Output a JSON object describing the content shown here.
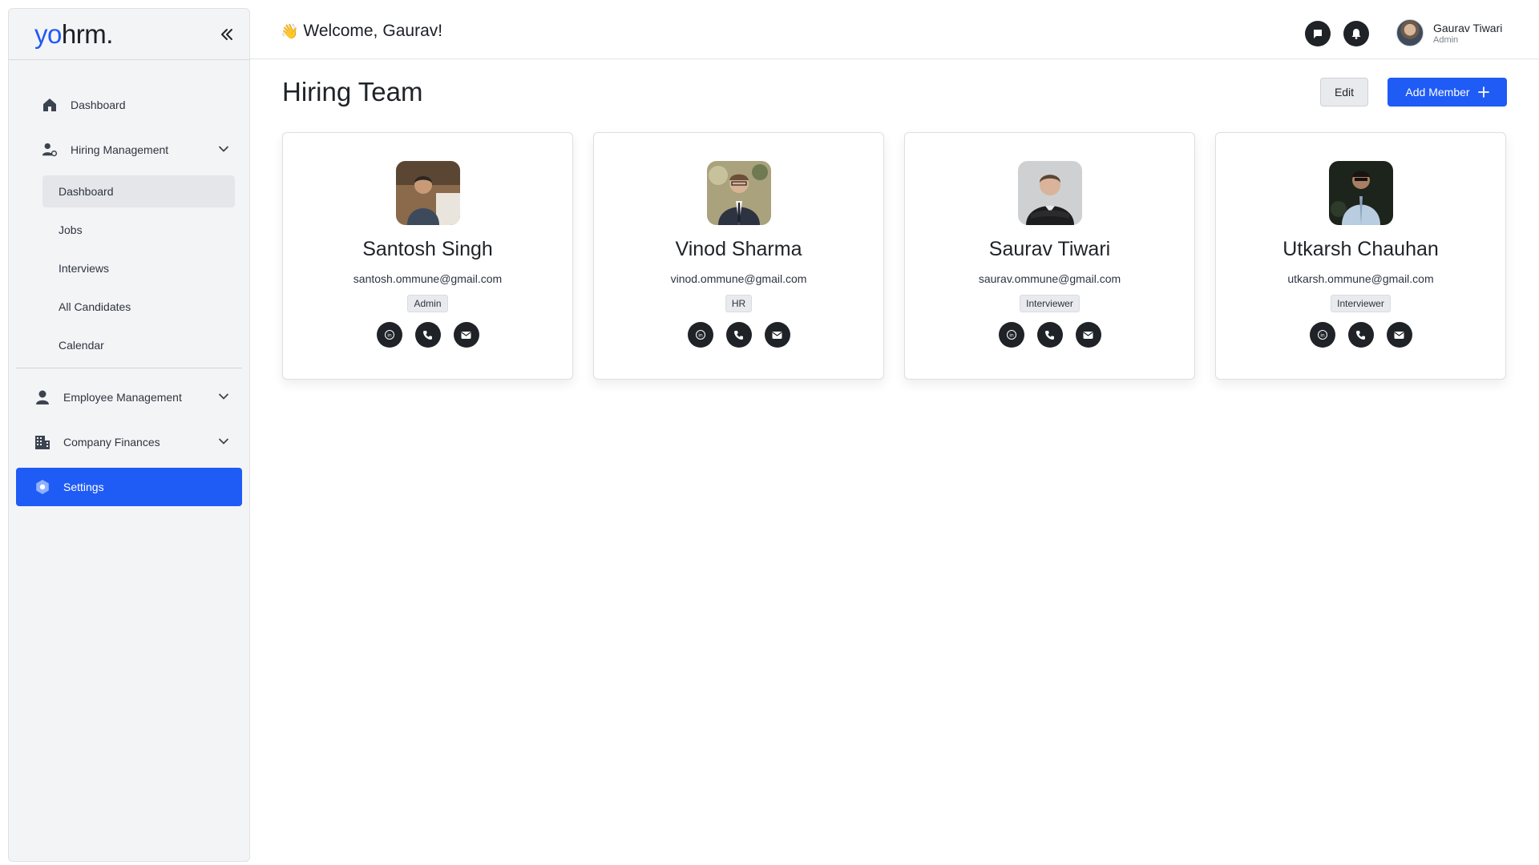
{
  "brand": {
    "logo_prefix": "yo",
    "logo_suffix": "hrm."
  },
  "sidebar": {
    "items": [
      {
        "label": "Dashboard",
        "icon": "home-icon"
      },
      {
        "label": "Hiring Management",
        "icon": "users-cog-icon"
      }
    ],
    "hiring_sub": [
      {
        "label": "Dashboard"
      },
      {
        "label": "Jobs"
      },
      {
        "label": "Interviews"
      },
      {
        "label": "All Candidates"
      },
      {
        "label": "Calendar"
      }
    ],
    "employee_management": "Employee Management",
    "company_finances": "Company Finances",
    "settings": "Settings"
  },
  "header": {
    "welcome_emoji": "👋",
    "welcome": "Welcome,",
    "welcome_name": "Gaurav!",
    "user_name": "Gaurav Tiwari",
    "user_role": "Admin"
  },
  "main": {
    "title": "Hiring Team",
    "edit_label": "Edit",
    "add_label": "Add Member"
  },
  "members": [
    {
      "name": "Santosh Singh",
      "email": "santosh.ommune@gmail.com",
      "role": "Admin"
    },
    {
      "name": "Vinod Sharma",
      "email": "vinod.ommune@gmail.com",
      "role": "HR"
    },
    {
      "name": "Saurav Tiwari",
      "email": "saurav.ommune@gmail.com",
      "role": "Interviewer"
    },
    {
      "name": "Utkarsh Chauhan",
      "email": "utkarsh.ommune@gmail.com",
      "role": "Interviewer"
    }
  ],
  "colors": {
    "primary": "#1f5bf5",
    "dark": "#1f2328",
    "sidebar_bg": "#f3f4f6"
  }
}
